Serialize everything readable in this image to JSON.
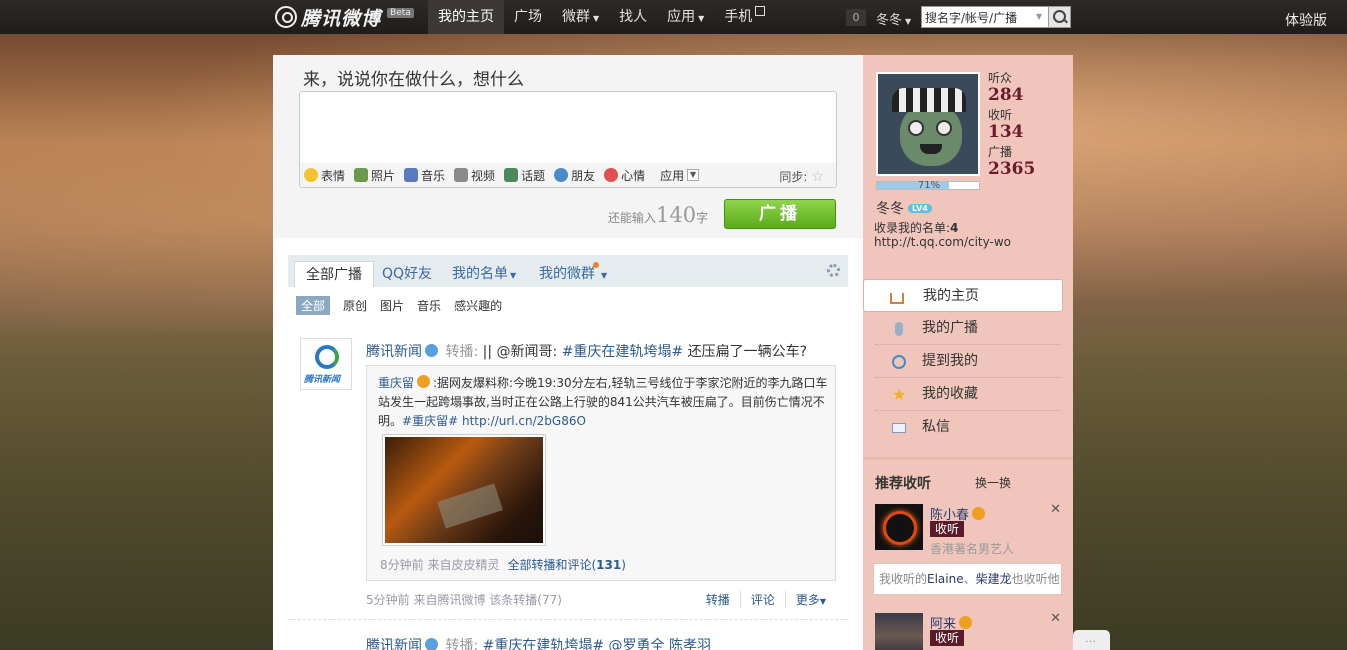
{
  "topbar": {
    "brand": "腾讯微博",
    "beta": "Beta",
    "nav": [
      {
        "label": "我的主页",
        "active": true
      },
      {
        "label": "广场"
      },
      {
        "label": "微群",
        "dropdown": true
      },
      {
        "label": "找人"
      },
      {
        "label": "应用",
        "dropdown": true
      },
      {
        "label": "手机",
        "gift": true
      }
    ],
    "notify_count": "0",
    "user": "冬冬",
    "search_value": "搜名字/帐号/广播",
    "trial": "体验版"
  },
  "composer": {
    "prompt": "来，说说你在做什么，想什么",
    "tools": [
      "表情",
      "照片",
      "音乐",
      "视频",
      "话题",
      "朋友",
      "心情"
    ],
    "apps": "应用",
    "sync": "同步:",
    "remain_prefix": "还能输入",
    "remain_num": "140",
    "remain_suffix": "字",
    "post": "广播"
  },
  "tabs": [
    "全部广播",
    "QQ好友",
    "我的名单",
    "我的微群"
  ],
  "subtabs": [
    "全部",
    "原创",
    "图片",
    "音乐",
    "感兴趣的"
  ],
  "feed": [
    {
      "author": "腾讯新闻",
      "rt": "转播:",
      "text_pre": "|| @新闻哥: ",
      "tag": "#重庆在建轨垮塌#",
      "text_post": " 还压扁了一辆公车?",
      "quote": {
        "author": "重庆留",
        "body": ":据网友爆料称:今晚19:30分左右,轻轨三号线位于李家沱附近的李九路口车站发生一起跨塌事故,当时正在公路上行驶的841公共汽车被压扁了。目前伤亡情况不明。",
        "tag": "#重庆留#",
        "link": "http://url.cn/2bG86O",
        "time": "8分钟前 来自皮皮精灵",
        "all_prefix": "全部转播和评论(",
        "all_count": "131",
        "all_suffix": ")"
      },
      "meta": "5分钟前 来自腾讯微博 该条转播(77)",
      "actions": [
        "转播",
        "评论",
        "更多"
      ]
    },
    {
      "author": "腾讯新闻",
      "rt": "转播:",
      "text": "#重庆在建轨垮塌# @罗勇全 陈孝羽"
    }
  ],
  "sidebar": {
    "stats": [
      {
        "label": "听众",
        "value": "284"
      },
      {
        "label": "收听",
        "value": "134"
      },
      {
        "label": "广播",
        "value": "2365"
      }
    ],
    "progress": 0.71,
    "progress_text": "71%",
    "name": "冬冬",
    "level": "LV4",
    "listed_label": "收录我的名单:",
    "listed_count": "4",
    "url": "http://t.qq.com/city-wo",
    "nav": [
      {
        "label": "我的主页",
        "icon": "home-icon",
        "active": true
      },
      {
        "label": "我的广播",
        "icon": "mic-icon"
      },
      {
        "label": "提到我的",
        "icon": "at-icon"
      },
      {
        "label": "我的收藏",
        "icon": "star-icon"
      },
      {
        "label": "私信",
        "icon": "mail-icon"
      }
    ],
    "rec_title": "推荐收听",
    "rec_swap": "换一换",
    "recs": [
      {
        "name": "陈小春",
        "follow": "收听",
        "desc": "香港著名男艺人"
      },
      {
        "name": "阿来",
        "follow": "收听",
        "desc": ""
      }
    ],
    "mutual_pre": "我收听的",
    "mutual_n1": "Elaine",
    "mutual_sep": "、",
    "mutual_n2": "柴建龙",
    "mutual_post": "也收听他"
  }
}
